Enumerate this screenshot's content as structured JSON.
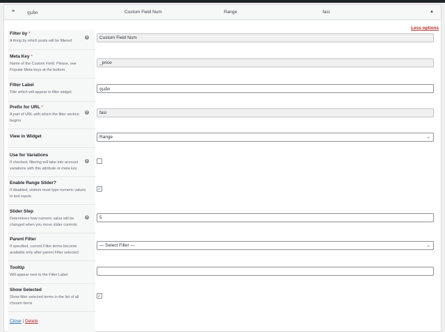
{
  "header": {
    "label": "ფასი",
    "type": "Custom Field Num",
    "view": "Range",
    "prefix": "fasi"
  },
  "less_options": "Less options",
  "fields": {
    "filter_by": {
      "label": "Filter by",
      "req": "*",
      "desc": "A thing by which posts will be filtered",
      "value": "Custom Field Num"
    },
    "meta_key": {
      "label": "Meta Key",
      "req": "*",
      "desc": "Name of the Custom Field. Please, see Popular Meta keys at the bottom",
      "value": "_price"
    },
    "filter_label": {
      "label": "Filter Label",
      "desc": "Title which will appear in filter widget",
      "value": "ფასი"
    },
    "prefix": {
      "label": "Prefix for URL",
      "req": "*",
      "desc": "A part of URL with which the filter section begins",
      "value": "fasi"
    },
    "view": {
      "label": "View in Widget",
      "value": "Range"
    },
    "variations": {
      "label": "Use for Variations",
      "desc": "If checked, filtering will take into account variations with this attribute or meta key",
      "checked": false
    },
    "range_slider": {
      "label": "Enable Range Slider?",
      "desc": "If disabled, visitors must type numeric values in text inputs",
      "checked": true
    },
    "slider_step": {
      "label": "Slider Step",
      "desc": "Determines how numeric value will be changed when you move slider controls",
      "value": "5"
    },
    "parent_filter": {
      "label": "Parent Filter",
      "desc": "If specified, current Filter terms become available only after parent Filter selected",
      "value": "— Select Filter —"
    },
    "tooltip": {
      "label": "Tooltip",
      "desc": "Will appear next to the Filter Label",
      "value": ""
    },
    "show_selected": {
      "label": "Show Selected",
      "desc": "Show filter selected terms in the list of all chosen items",
      "checked": true
    }
  },
  "actions": {
    "close": "Close",
    "separator": "|",
    "delete": "Delete"
  },
  "icons": {
    "drag": "hamburger-icon",
    "toggle": "triangle-up-icon",
    "help": "question-circle-icon",
    "select": "chevron-down-icon",
    "check": "checkmark-icon"
  }
}
